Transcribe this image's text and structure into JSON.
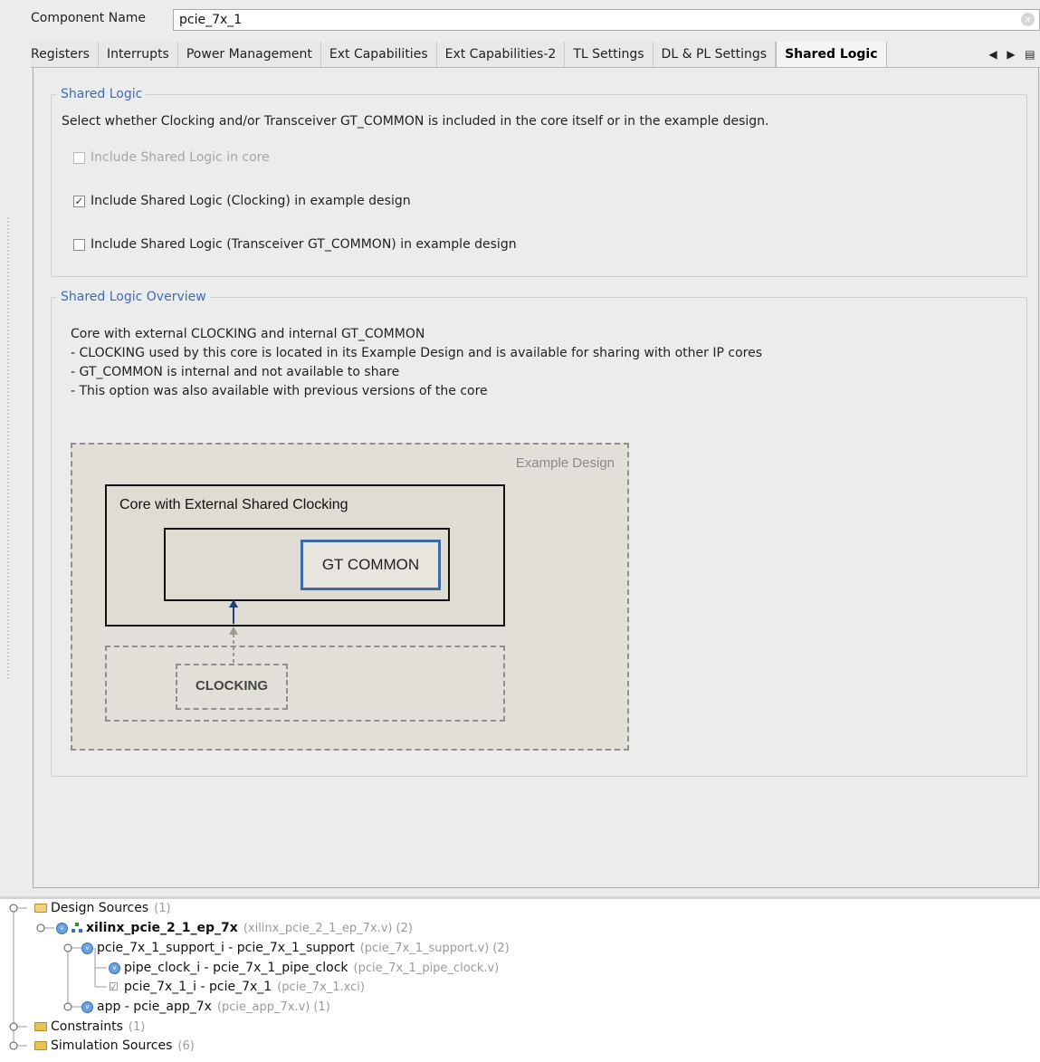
{
  "component": {
    "label": "Component Name",
    "value": "pcie_7x_1"
  },
  "tabs": [
    {
      "label": "Registers",
      "active": false
    },
    {
      "label": "Interrupts",
      "active": false
    },
    {
      "label": "Power Management",
      "active": false
    },
    {
      "label": "Ext Capabilities",
      "active": false
    },
    {
      "label": "Ext Capabilities-2",
      "active": false
    },
    {
      "label": "TL Settings",
      "active": false
    },
    {
      "label": "DL & PL Settings",
      "active": false
    },
    {
      "label": "Shared Logic",
      "active": true
    }
  ],
  "tab_nav": {
    "prev": "◀",
    "next": "▶",
    "menu": "▤"
  },
  "shared_logic": {
    "title": "Shared Logic",
    "description": "Select whether Clocking and/or Transceiver GT_COMMON is included in the core itself or in the example design.",
    "options": [
      {
        "label": "Include Shared Logic in core",
        "checked": false,
        "enabled": false
      },
      {
        "label": "Include Shared Logic (Clocking) in example design",
        "checked": true,
        "enabled": true
      },
      {
        "label": "Include Shared Logic (Transceiver GT_COMMON) in example design",
        "checked": false,
        "enabled": true
      }
    ]
  },
  "overview": {
    "title": "Shared Logic Overview",
    "lines": [
      "Core with external CLOCKING and internal GT_COMMON",
      "- CLOCKING used by this core is located in its Example Design and is available for sharing with other IP cores",
      "- GT_COMMON is internal and not available to share",
      "- This option was also available with previous versions of the core"
    ],
    "diagram": {
      "example_label": "Example Design",
      "core_label": "Core with External Shared Clocking",
      "gt_label": "GT COMMON",
      "clocking_label": "CLOCKING",
      "gt_border_color": "#3d6aa8",
      "arrow_color": "#1e3f73"
    }
  },
  "tree": {
    "design_sources": {
      "label": "Design Sources",
      "count": "(1)"
    },
    "top": {
      "label": "xilinx_pcie_2_1_ep_7x",
      "file": "(xilinx_pcie_2_1_ep_7x.v)",
      "count": "(2)"
    },
    "support": {
      "label": "pcie_7x_1_support_i - pcie_7x_1_support",
      "file": "(pcie_7x_1_support.v)",
      "count": "(2)"
    },
    "pipe_clock": {
      "label": "pipe_clock_i - pcie_7x_1_pipe_clock",
      "file": "(pcie_7x_1_pipe_clock.v)"
    },
    "pcie_i": {
      "label": "pcie_7x_1_i - pcie_7x_1",
      "file": "(pcie_7x_1.xci)"
    },
    "app": {
      "label": "app - pcie_app_7x",
      "file": "(pcie_app_7x.v)",
      "count": "(1)"
    },
    "constraints": {
      "label": "Constraints",
      "count": "(1)"
    },
    "sim_sources": {
      "label": "Simulation Sources",
      "count": "(6)"
    }
  }
}
